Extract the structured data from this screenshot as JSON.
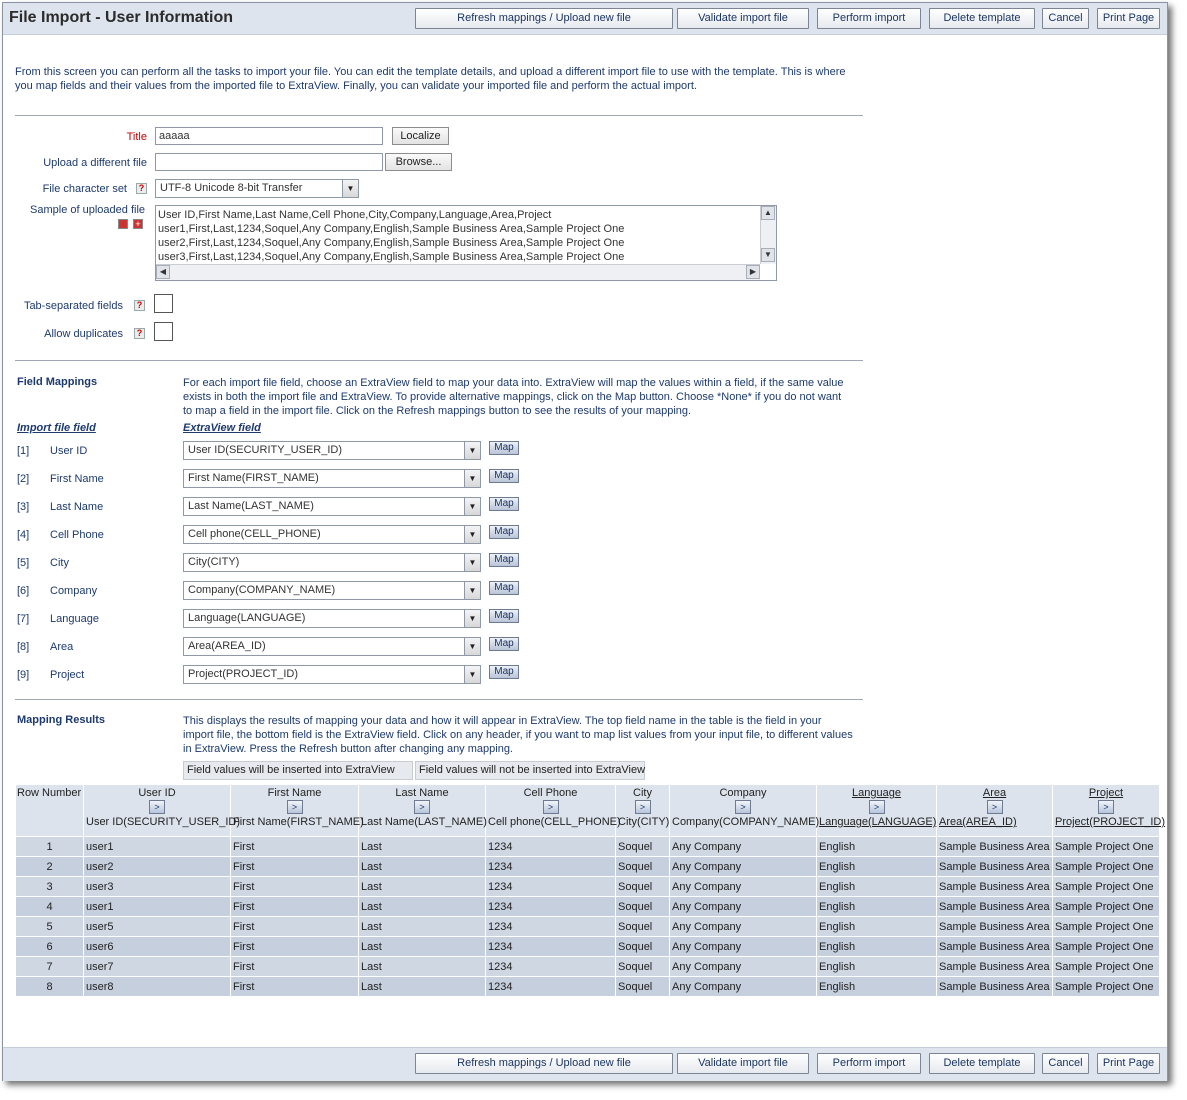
{
  "title": "File Import - User Information",
  "toolbar": {
    "refresh": "Refresh mappings / Upload new file",
    "validate": "Validate import file",
    "perform": "Perform import",
    "delete": "Delete template",
    "cancel": "Cancel",
    "print": "Print Page"
  },
  "intro": "From this screen you can perform all the tasks to import your file. You can edit the template details, and upload a different import file to use with the template. This is where you map fields and their values from the imported file to ExtraView. Finally, you can validate your imported file and perform the actual import.",
  "form": {
    "title_label": "Title",
    "title_value": "aaaaa",
    "localize": "Localize",
    "upload_label": "Upload a different file",
    "browse": "Browse...",
    "charset_label": "File character set",
    "charset_value": "UTF-8 Unicode 8-bit Transfer",
    "sample_label": "Sample of uploaded file",
    "sample_lines": [
      "User ID,First Name,Last Name,Cell Phone,City,Company,Language,Area,Project",
      "user1,First,Last,1234,Soquel,Any Company,English,Sample Business Area,Sample Project One",
      "user2,First,Last,1234,Soquel,Any Company,English,Sample Business Area,Sample Project One",
      "user3,First,Last,1234,Soquel,Any Company,English,Sample Business Area,Sample Project One"
    ],
    "tab_label": "Tab-separated fields",
    "dup_label": "Allow duplicates",
    "help_glyph": "?"
  },
  "mappings": {
    "title": "Field Mappings",
    "description": "For each import file field, choose an ExtraView field to map your data into. ExtraView will map the values within a field, if the same value exists in both the import file and ExtraView. To provide alternative mappings, click on the Map button. Choose *None* if you do not want to map a field in the import file. Click on the Refresh mappings button to see the results of your mapping.",
    "col_import": "Import file field",
    "col_extraview": "ExtraView field",
    "map_label": "Map",
    "rows": [
      {
        "num": "[1]",
        "name": "User ID",
        "field": "User ID(SECURITY_USER_ID)"
      },
      {
        "num": "[2]",
        "name": "First Name",
        "field": "First Name(FIRST_NAME)"
      },
      {
        "num": "[3]",
        "name": "Last Name",
        "field": "Last Name(LAST_NAME)"
      },
      {
        "num": "[4]",
        "name": "Cell Phone",
        "field": "Cell phone(CELL_PHONE)"
      },
      {
        "num": "[5]",
        "name": "City",
        "field": "City(CITY)"
      },
      {
        "num": "[6]",
        "name": "Company",
        "field": "Company(COMPANY_NAME)"
      },
      {
        "num": "[7]",
        "name": "Language",
        "field": "Language(LANGUAGE)"
      },
      {
        "num": "[8]",
        "name": "Area",
        "field": "Area(AREA_ID)"
      },
      {
        "num": "[9]",
        "name": "Project",
        "field": "Project(PROJECT_ID)"
      }
    ]
  },
  "results": {
    "title": "Mapping Results",
    "description": "This displays the results of mapping your data and how it will appear in ExtraView. The top field name in the table is the field in your import file, the bottom field is the ExtraView field. Click on any header, if you want to map list values from your input file, to different values in ExtraView. Press the Refresh button after changing any mapping.",
    "legend_inserted": "Field values will be inserted into ExtraView",
    "legend_not_inserted": "Field values will not be inserted into ExtraView",
    "row_number_header": "Row Number",
    "columns": [
      {
        "top": "User ID",
        "bottom": "User ID(SECURITY_USER_ID)"
      },
      {
        "top": "First Name",
        "bottom": "First Name(FIRST_NAME)"
      },
      {
        "top": "Last Name",
        "bottom": "Last Name(LAST_NAME)"
      },
      {
        "top": "Cell Phone",
        "bottom": "Cell phone(CELL_PHONE)"
      },
      {
        "top": "City",
        "bottom": "City(CITY)"
      },
      {
        "top": "Company",
        "bottom": "Company(COMPANY_NAME)"
      },
      {
        "top": "Language",
        "bottom": "Language(LANGUAGE)"
      },
      {
        "top": "Area",
        "bottom": "Area(AREA_ID)"
      },
      {
        "top": "Project",
        "bottom": "Project(PROJECT_ID)"
      }
    ],
    "rows": [
      [
        "1",
        "user1",
        "First",
        "Last",
        "1234",
        "Soquel",
        "Any Company",
        "English",
        "Sample Business Area",
        "Sample Project One"
      ],
      [
        "2",
        "user2",
        "First",
        "Last",
        "1234",
        "Soquel",
        "Any Company",
        "English",
        "Sample Business Area",
        "Sample Project One"
      ],
      [
        "3",
        "user3",
        "First",
        "Last",
        "1234",
        "Soquel",
        "Any Company",
        "English",
        "Sample Business Area",
        "Sample Project One"
      ],
      [
        "4",
        "user1",
        "First",
        "Last",
        "1234",
        "Soquel",
        "Any Company",
        "English",
        "Sample Business Area",
        "Sample Project One"
      ],
      [
        "5",
        "user5",
        "First",
        "Last",
        "1234",
        "Soquel",
        "Any Company",
        "English",
        "Sample Business Area",
        "Sample Project One"
      ],
      [
        "6",
        "user6",
        "First",
        "Last",
        "1234",
        "Soquel",
        "Any Company",
        "English",
        "Sample Business Area",
        "Sample Project One"
      ],
      [
        "7",
        "user7",
        "First",
        "Last",
        "1234",
        "Soquel",
        "Any Company",
        "English",
        "Sample Business Area",
        "Sample Project One"
      ],
      [
        "8",
        "user8",
        "First",
        "Last",
        "1234",
        "Soquel",
        "Any Company",
        "English",
        "Sample Business Area",
        "Sample Project One"
      ]
    ]
  },
  "colors": {
    "title_bar": "#dde4ee",
    "text": "#1d3a6e",
    "required": "#cc0000",
    "table_header": "#dde3ec",
    "table_cell": "#cfd7e3"
  }
}
